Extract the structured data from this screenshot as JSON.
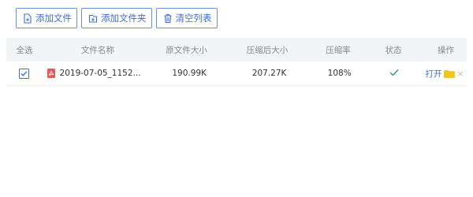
{
  "toolbar": {
    "add_file_label": "添加文件",
    "add_folder_label": "添加文件夹",
    "clear_list_label": "清空列表"
  },
  "table": {
    "headers": {
      "select_all": "全选",
      "file_name": "文件名称",
      "original_size": "原文件大小",
      "compressed_size": "压缩后大小",
      "ratio": "压缩率",
      "status": "状态",
      "actions": "操作"
    },
    "rows": [
      {
        "checked": true,
        "file_name": "2019-07-05_1152...",
        "original_size": "190.99K",
        "compressed_size": "207.27K",
        "ratio": "108%",
        "status": "done",
        "open_label": "打开",
        "remove_label": "×"
      }
    ]
  },
  "colors": {
    "accent": "#3f6fd6",
    "header_bg": "#f3f4f6",
    "success": "#2e9b6f",
    "pdf_red": "#e45a5a",
    "folder_yellow": "#f5c518"
  },
  "icons": {
    "add_file": "file-plus-icon",
    "add_folder": "folder-plus-icon",
    "clear_list": "trash-icon",
    "file_type": "pdf-icon",
    "status": "checkmark-icon",
    "open_folder": "folder-icon",
    "remove": "close-icon"
  }
}
